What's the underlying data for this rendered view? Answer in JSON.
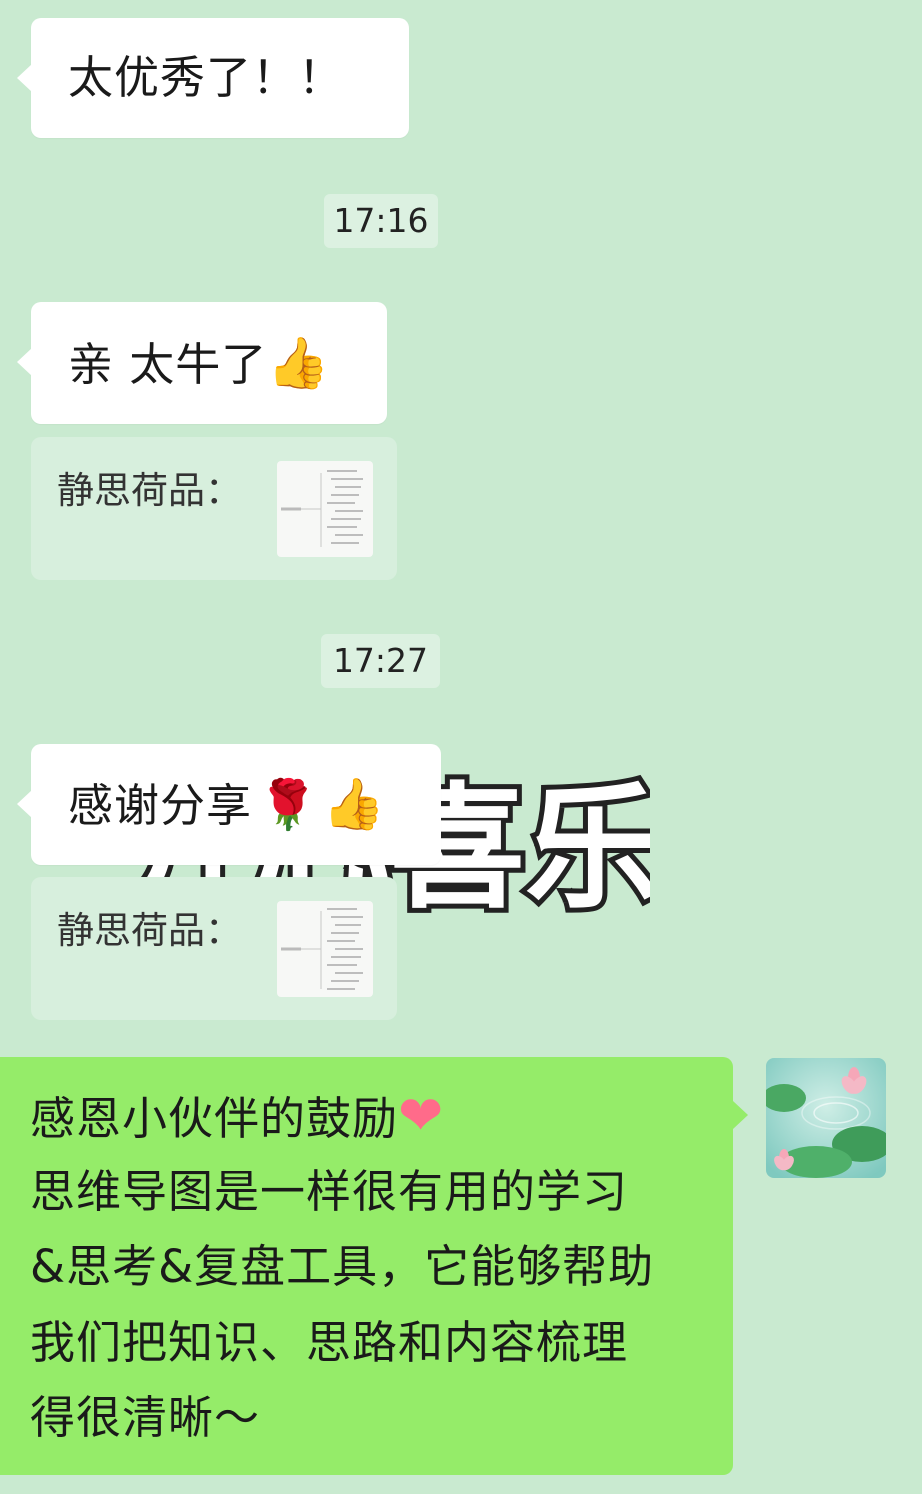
{
  "messages": {
    "m1": {
      "text": "太优秀了！！"
    },
    "time1": "17:16",
    "m2": {
      "text": "亲 太牛了",
      "emoji": "👍"
    },
    "quote1": {
      "label": "静思荷品："
    },
    "time2": "17:27",
    "m3": {
      "text": "感谢分享",
      "emoji1": "🌹",
      "emoji2": "👍"
    },
    "quote2": {
      "label": "静思荷品："
    },
    "sticker": {
      "text": "开心喜乐"
    },
    "outgoing": {
      "line1": "感恩小伙伴的鼓励",
      "heart": "❤",
      "line2": "思维导图是一样很有用的学习",
      "line3": "&思考&复盘工具，它能够帮助",
      "line4": "我们把知识、思路和内容梳理",
      "line5": "得很清晰～"
    }
  },
  "colors": {
    "background": "#c9ead0",
    "incoming_bubble": "#ffffff",
    "outgoing_bubble": "#95ec69",
    "quote_card": "#d7efdd",
    "time_pill": "#dcf1e1",
    "heart": "#ff6b8a"
  },
  "icons": {
    "avatar": "lotus-pond-avatar",
    "quote_thumb": "mind-map-thumbnail"
  }
}
